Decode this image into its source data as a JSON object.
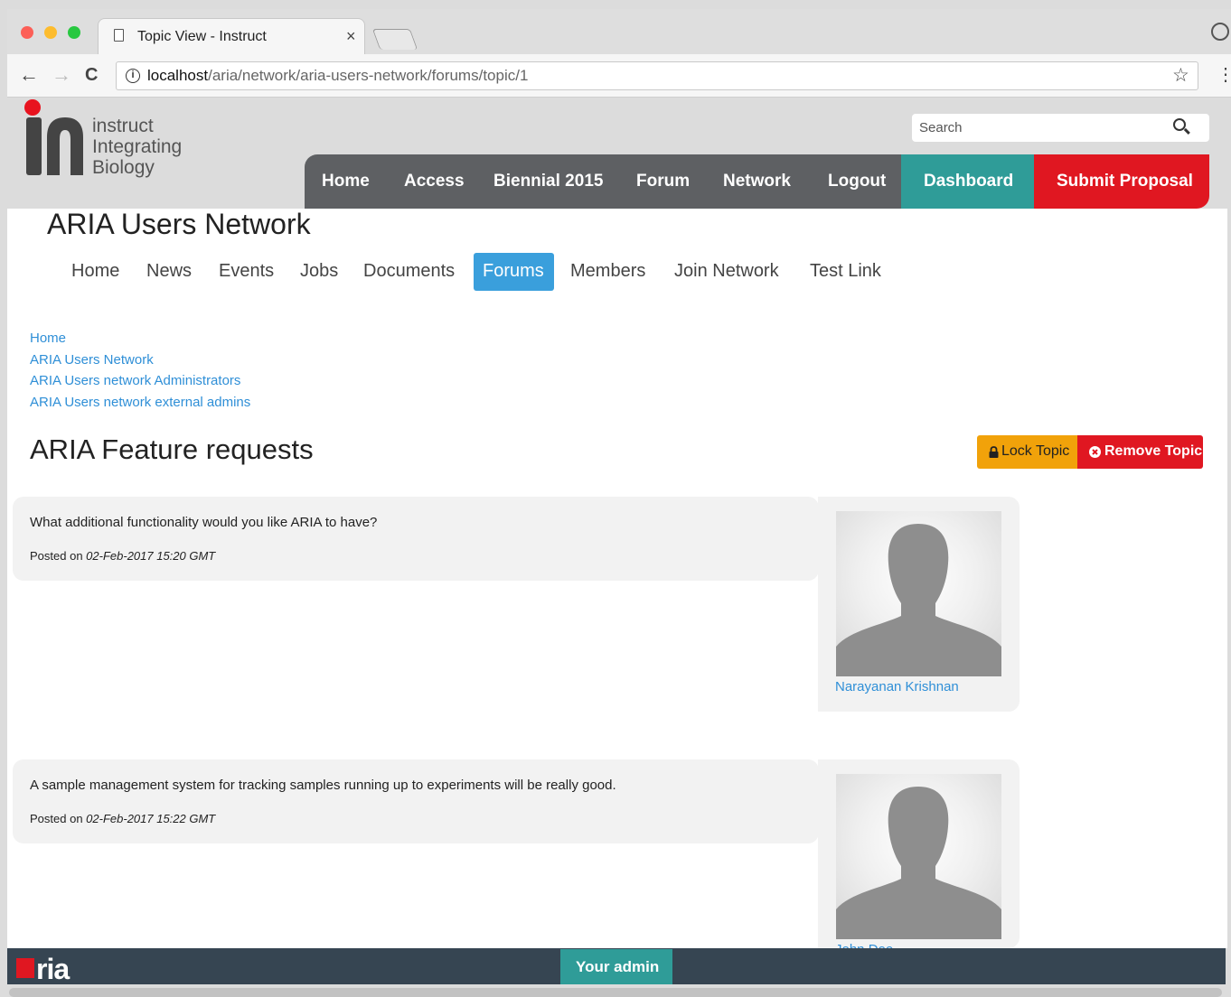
{
  "browser": {
    "tab_title": "Topic View - Instruct",
    "tab_close": "×",
    "url_host": "localhost",
    "url_path": "/aria/network/aria-users-network/forums/topic/1",
    "back_glyph": "←",
    "forward_glyph": "→",
    "reload_glyph": "C",
    "info_glyph": "i",
    "star_glyph": "☆",
    "menu_glyph": "⋮"
  },
  "header": {
    "logo_lines": [
      "instruct",
      "Integrating",
      "Biology"
    ],
    "search_placeholder": "Search",
    "main_nav": [
      "Home",
      "Access",
      "Biennial 2015",
      "Forum",
      "Network",
      "Logout"
    ],
    "dashboard_label": "Dashboard",
    "submit_label": "Submit Proposal",
    "colors": {
      "dashboard": "#2f9c98",
      "submit": "#e01721",
      "nav": "#5e6063"
    }
  },
  "network": {
    "title": "ARIA Users Network",
    "sub_nav": [
      "Home",
      "News",
      "Events",
      "Jobs",
      "Documents",
      "Forums",
      "Members",
      "Join Network",
      "Test Link"
    ],
    "active_sub_nav": "Forums"
  },
  "breadcrumbs": [
    "Home",
    "ARIA Users Network",
    "ARIA Users network Administrators",
    "ARIA Users network external admins"
  ],
  "topic": {
    "title": "ARIA Feature requests",
    "lock_label": "Lock Topic",
    "remove_label": "Remove Topic",
    "posts": [
      {
        "text": "What additional functionality would you like ARIA to have?",
        "posted_prefix": "Posted on",
        "date": "02-Feb-2017 15:20 GMT",
        "author": "Narayanan Krishnan"
      },
      {
        "text": "A sample management system for tracking samples running up to experiments will be really good.",
        "posted_prefix": "Posted on",
        "date": "02-Feb-2017 15:22 GMT",
        "author": "John Doe"
      }
    ]
  },
  "footer": {
    "logo_text": "ria",
    "admin_label": "Your admin"
  }
}
